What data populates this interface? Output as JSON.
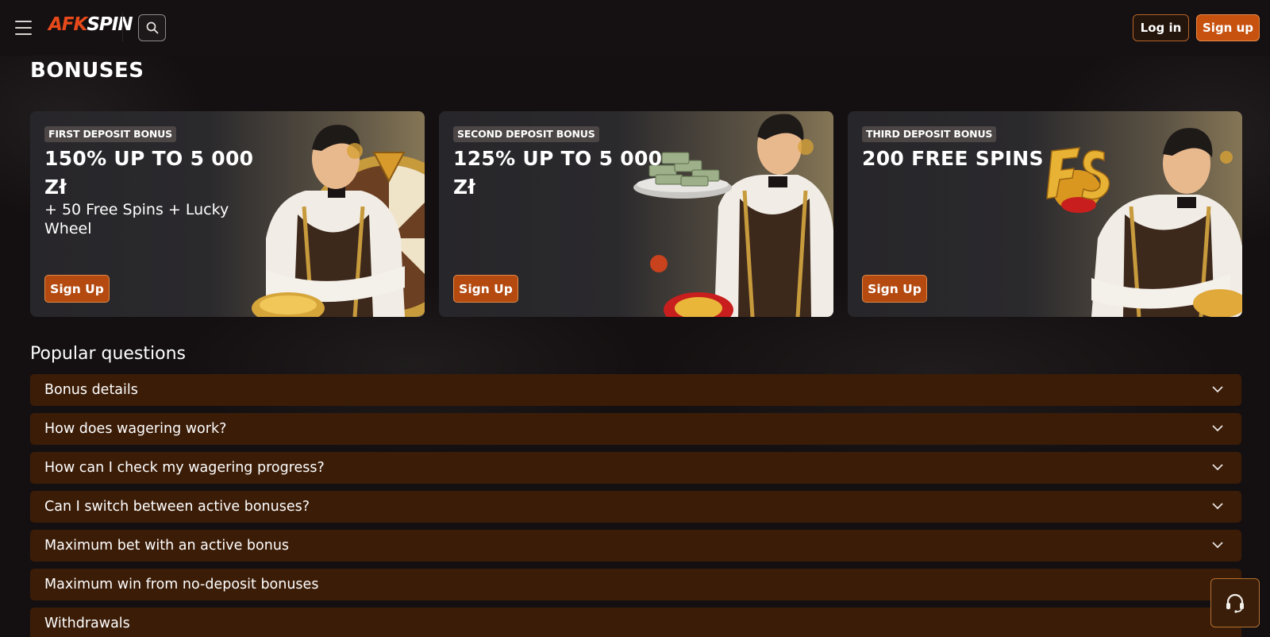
{
  "header": {
    "logo_part1": "AFK",
    "logo_part2": "SPIN",
    "login_label": "Log in",
    "signup_label": "Sign up"
  },
  "page": {
    "title": "BONUSES"
  },
  "bonuses": [
    {
      "tag": "FIRST DEPOSIT BONUS",
      "headline": "150% UP TO 5 000 Zł",
      "sub": "+ 50 Free Spins + Lucky Wheel",
      "cta": "Sign Up"
    },
    {
      "tag": "SECOND DEPOSIT BONUS",
      "headline": "125% UP TO 5 000 Zł",
      "sub": "",
      "cta": "Sign Up"
    },
    {
      "tag": "THIRD DEPOSIT BONUS",
      "headline": "200 FREE SPINS",
      "sub": "",
      "cta": "Sign Up"
    }
  ],
  "faq": {
    "title": "Popular questions",
    "items": [
      "Bonus details",
      "How does wagering work?",
      "How can I check my wagering progress?",
      "Can I switch between active bonuses?",
      "Maximum bet with an active bonus",
      "Maximum win from no-deposit bonuses",
      "Withdrawals"
    ]
  },
  "colors": {
    "background": "#141011",
    "accent": "#c7520f",
    "faq_row": "#3b1c07",
    "logo_accent": "#e74a1a"
  },
  "icons": {
    "menu": "hamburger-icon",
    "search": "search-icon",
    "chevron": "chevron-down-icon",
    "support": "headset-icon"
  }
}
